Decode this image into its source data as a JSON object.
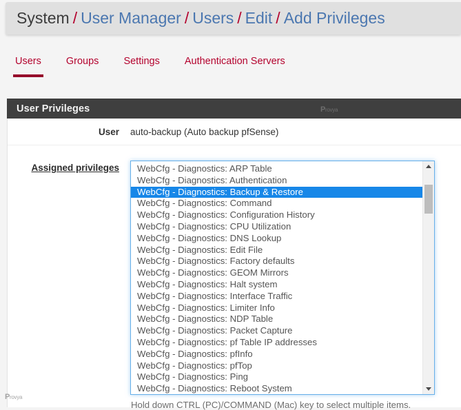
{
  "breadcrumb": {
    "separator": "/",
    "items": [
      {
        "label": "System",
        "link": false
      },
      {
        "label": "User Manager",
        "link": true
      },
      {
        "label": "Users",
        "link": true
      },
      {
        "label": "Edit",
        "link": true
      },
      {
        "label": "Add Privileges",
        "link": true
      }
    ]
  },
  "tabs": [
    {
      "label": "Users",
      "active": true
    },
    {
      "label": "Groups",
      "active": false
    },
    {
      "label": "Settings",
      "active": false
    },
    {
      "label": "Authentication Servers",
      "active": false
    }
  ],
  "panel": {
    "title": "User Privileges",
    "watermark": {
      "first": "P",
      "rest": "rovya"
    }
  },
  "form": {
    "user": {
      "label": "User",
      "value": "auto-backup (Auto backup pfSense)"
    },
    "assigned_privileges": {
      "label": "Assigned privileges",
      "help": "Hold down CTRL (PC)/COMMAND (Mac) key to select multiple items.",
      "options": [
        {
          "label": "WebCfg - Diagnostics: ARP Table",
          "selected": false
        },
        {
          "label": "WebCfg - Diagnostics: Authentication",
          "selected": false
        },
        {
          "label": "WebCfg - Diagnostics: Backup & Restore",
          "selected": true
        },
        {
          "label": "WebCfg - Diagnostics: Command",
          "selected": false
        },
        {
          "label": "WebCfg - Diagnostics: Configuration History",
          "selected": false
        },
        {
          "label": "WebCfg - Diagnostics: CPU Utilization",
          "selected": false
        },
        {
          "label": "WebCfg - Diagnostics: DNS Lookup",
          "selected": false
        },
        {
          "label": "WebCfg - Diagnostics: Edit File",
          "selected": false
        },
        {
          "label": "WebCfg - Diagnostics: Factory defaults",
          "selected": false
        },
        {
          "label": "WebCfg - Diagnostics: GEOM Mirrors",
          "selected": false
        },
        {
          "label": "WebCfg - Diagnostics: Halt system",
          "selected": false
        },
        {
          "label": "WebCfg - Diagnostics: Interface Traffic",
          "selected": false
        },
        {
          "label": "WebCfg - Diagnostics: Limiter Info",
          "selected": false
        },
        {
          "label": "WebCfg - Diagnostics: NDP Table",
          "selected": false
        },
        {
          "label": "WebCfg - Diagnostics: Packet Capture",
          "selected": false
        },
        {
          "label": "WebCfg - Diagnostics: pf Table IP addresses",
          "selected": false
        },
        {
          "label": "WebCfg - Diagnostics: pfInfo",
          "selected": false
        },
        {
          "label": "WebCfg - Diagnostics: pfTop",
          "selected": false
        },
        {
          "label": "WebCfg - Diagnostics: Ping",
          "selected": false
        },
        {
          "label": "WebCfg - Diagnostics: Reboot System",
          "selected": false
        }
      ]
    }
  },
  "colors": {
    "accent_red": "#b4032e",
    "accent_red_dark": "#96092a",
    "link_blue": "#4b77b0",
    "panel_header": "#3f3f3f",
    "selection_blue": "#1787e8",
    "focus_border": "#66afe9"
  }
}
